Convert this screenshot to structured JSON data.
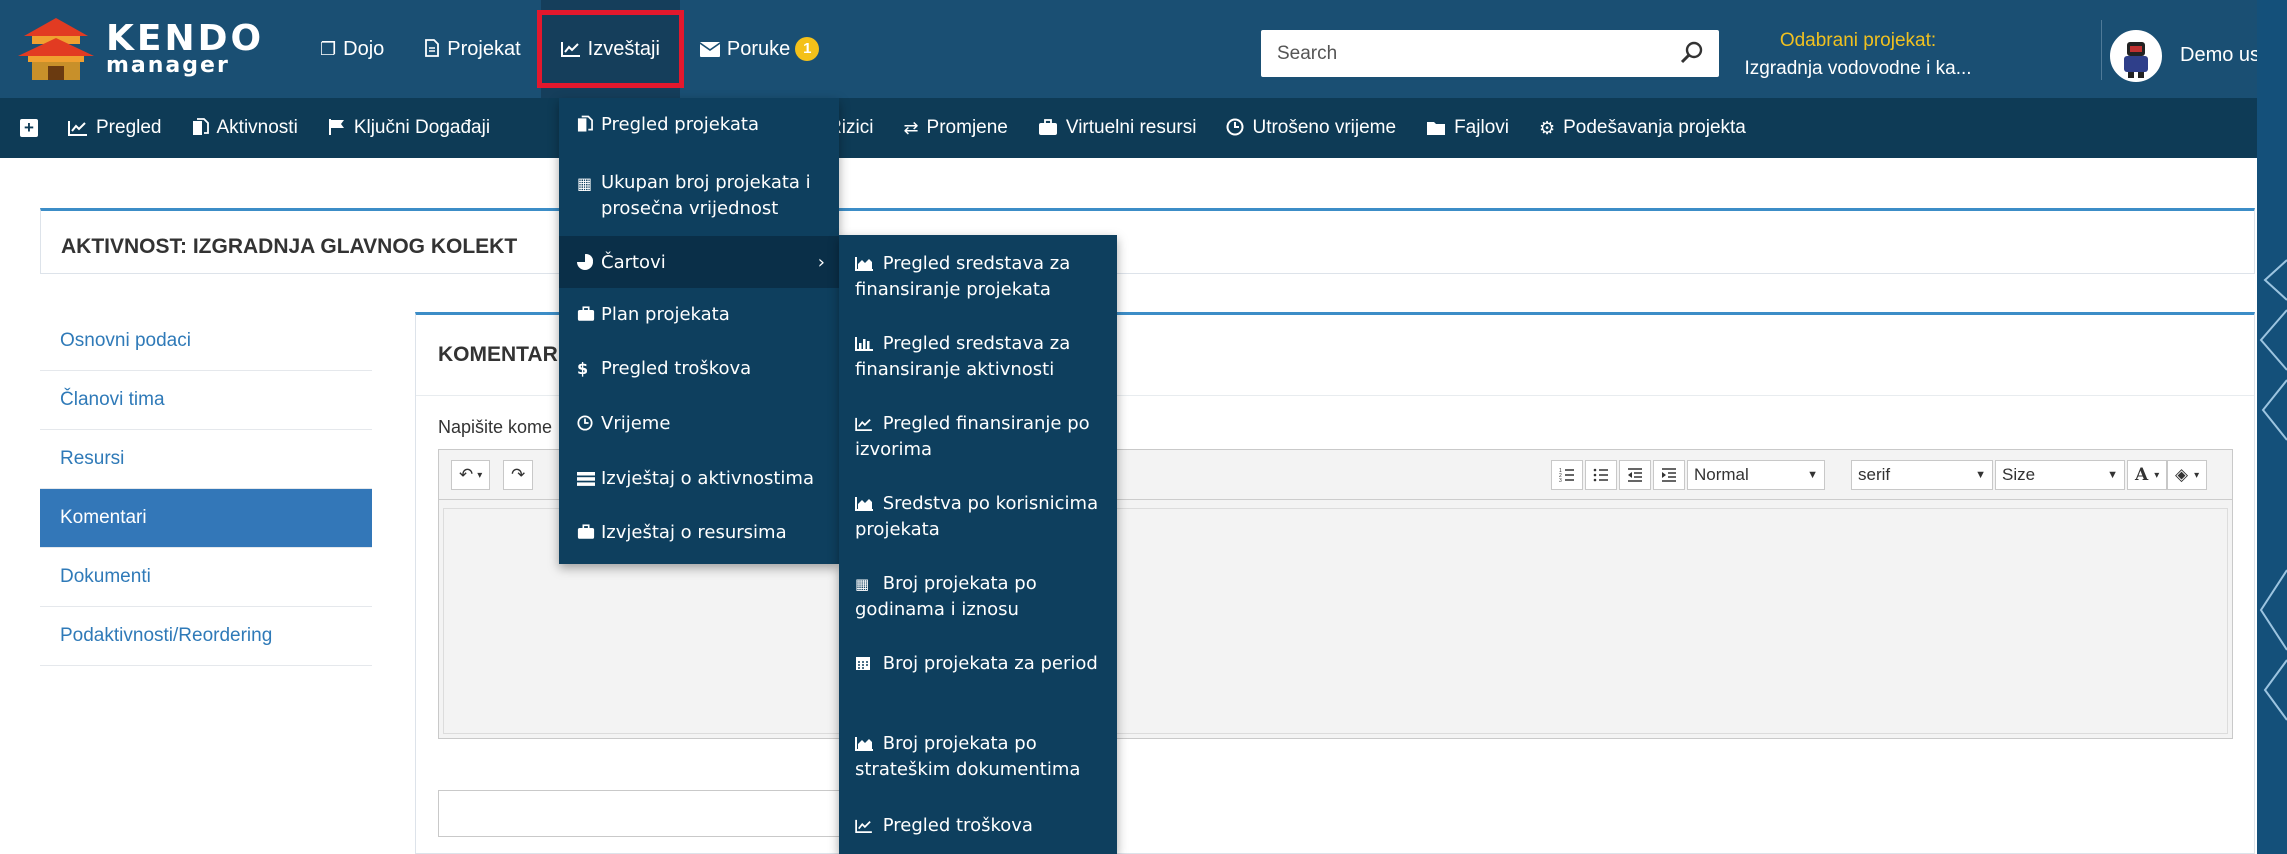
{
  "logo": {
    "line1": "KENDO",
    "line2": "manager"
  },
  "topnav": [
    {
      "label": "Dojo",
      "icon": "window-icon"
    },
    {
      "label": "Projekat",
      "icon": "document-icon"
    },
    {
      "label": "Izveštaji",
      "icon": "line-chart-icon",
      "active": true
    },
    {
      "label": "Poruke",
      "icon": "envelope-icon",
      "badge": "1"
    }
  ],
  "search": {
    "placeholder": "Search"
  },
  "project": {
    "label": "Odabrani projekat:",
    "name": "Izgradnja vodovodne i ka..."
  },
  "user": {
    "name": "Demo user"
  },
  "subnav": [
    {
      "label": "Pregled",
      "icon": "line-chart-icon"
    },
    {
      "label": "Aktivnosti",
      "icon": "files-icon"
    },
    {
      "label": "Ključni Događaji",
      "icon": "flag-icon"
    },
    {
      "label": "Rizici",
      "icon": "warning-icon"
    },
    {
      "label": "Promjene",
      "icon": "exchange-icon"
    },
    {
      "label": "Virtuelni resursi",
      "icon": "briefcase-icon"
    },
    {
      "label": "Utrošeno vrijeme",
      "icon": "clock-icon"
    },
    {
      "label": "Fajlovi",
      "icon": "folder-icon"
    },
    {
      "label": "Podešavanja projekta",
      "icon": "gears-icon"
    }
  ],
  "page_title": "AKTIVNOST: IZGRADNJA GLAVNOG KOLEKT",
  "sidenav": [
    {
      "label": "Osnovni podaci"
    },
    {
      "label": "Članovi tima"
    },
    {
      "label": "Resursi"
    },
    {
      "label": "Komentari",
      "active": true
    },
    {
      "label": "Dokumenti"
    },
    {
      "label": "Podaktivnosti/Reordering"
    }
  ],
  "comment_panel": {
    "title": "KOMENTAR",
    "label": "Napišite kome",
    "toolbar": {
      "format": "Normal",
      "font": "serif",
      "size": "Size",
      "color_label": "A"
    }
  },
  "reports_menu": [
    {
      "label": "Pregled projekata",
      "icon": "files-icon"
    },
    {
      "label": "Ukupan broj projekata i prosečna vrijednost",
      "icon": "calculator-icon"
    },
    {
      "label": "Čartovi",
      "icon": "pie-chart-icon",
      "submenu": true
    },
    {
      "label": "Plan projekata",
      "icon": "briefcase-icon"
    },
    {
      "label": "Pregled troškova",
      "icon": "dollar-icon"
    },
    {
      "label": "Vrijeme",
      "icon": "clock-icon"
    },
    {
      "label": "Izvještaj o aktivnostima",
      "icon": "tasks-icon"
    },
    {
      "label": "Izvještaj o resursima",
      "icon": "briefcase-icon"
    }
  ],
  "charts_submenu": [
    {
      "label": "Pregled sredstava za finansiranje projekata",
      "icon": "area-chart-icon"
    },
    {
      "label": "Pregled sredstava za finansiranje aktivnosti",
      "icon": "bar-chart-icon"
    },
    {
      "label": "Pregled finansiranje po izvorima",
      "icon": "line-chart-icon"
    },
    {
      "label": "Sredstva po korisnicima projekata",
      "icon": "area-chart-icon"
    },
    {
      "label": "Broj projekata po godinama i iznosu",
      "icon": "calculator-icon"
    },
    {
      "label": "Broj projekata za period",
      "icon": "calendar-icon"
    },
    {
      "label": "Broj projekata po strateškim dokumentima",
      "icon": "area-chart-icon"
    },
    {
      "label": "Pregled troškova",
      "icon": "line-chart-icon"
    }
  ]
}
